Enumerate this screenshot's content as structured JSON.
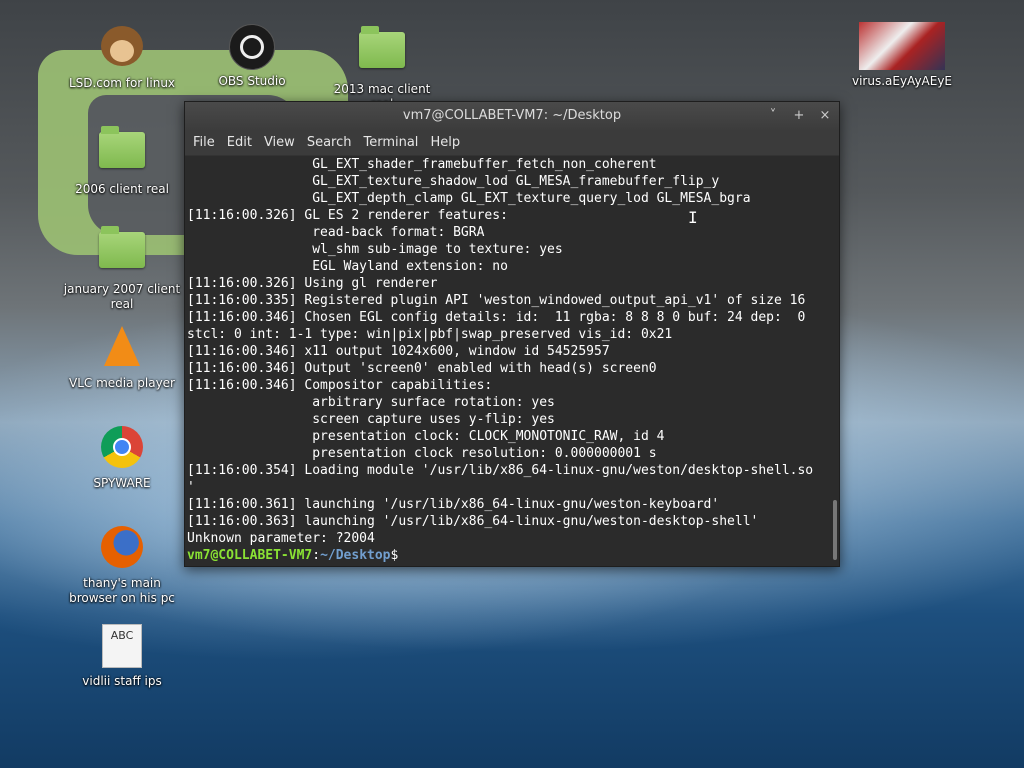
{
  "desktop": {
    "icons": [
      {
        "label": "LSD.com for linux",
        "icon": "monkey-icon"
      },
      {
        "label": "OBS Studio",
        "icon": "obs-icon"
      },
      {
        "label": "2013 mac client real",
        "icon": "folder-icon"
      },
      {
        "label": "virus.aEyAyAEyE",
        "icon": "image-thumbnail-icon"
      },
      {
        "label": "2006 client real",
        "icon": "folder-icon"
      },
      {
        "label": "january 2007 client real",
        "icon": "folder-icon"
      },
      {
        "label": "VLC media player",
        "icon": "vlc-icon"
      },
      {
        "label": "SPYWARE",
        "icon": "chrome-icon"
      },
      {
        "label": "thany's main browser on his pc",
        "icon": "firefox-icon"
      },
      {
        "label": "vidlii staff ips",
        "icon": "text-file-icon"
      }
    ]
  },
  "terminal": {
    "title": "vm7@COLLABET-VM7: ~/Desktop",
    "controls": {
      "minimize": "˅",
      "maximize": "+",
      "close": "×"
    },
    "menu": [
      "File",
      "Edit",
      "View",
      "Search",
      "Terminal",
      "Help"
    ],
    "lines": [
      "                GL_EXT_shader_framebuffer_fetch_non_coherent",
      "                GL_EXT_texture_shadow_lod GL_MESA_framebuffer_flip_y",
      "                GL_EXT_depth_clamp GL_EXT_texture_query_lod GL_MESA_bgra",
      "[11:16:00.326] GL ES 2 renderer features:",
      "                read-back format: BGRA",
      "                wl_shm sub-image to texture: yes",
      "                EGL Wayland extension: no",
      "[11:16:00.326] Using gl renderer",
      "[11:16:00.335] Registered plugin API 'weston_windowed_output_api_v1' of size 16",
      "[11:16:00.346] Chosen EGL config details: id:  11 rgba: 8 8 8 0 buf: 24 dep:  0",
      "stcl: 0 int: 1-1 type: win|pix|pbf|swap_preserved vis_id: 0x21",
      "[11:16:00.346] x11 output 1024x600, window id 54525957",
      "[11:16:00.346] Output 'screen0' enabled with head(s) screen0",
      "[11:16:00.346] Compositor capabilities:",
      "                arbitrary surface rotation: yes",
      "                screen capture uses y-flip: yes",
      "                presentation clock: CLOCK_MONOTONIC_RAW, id 4",
      "                presentation clock resolution: 0.000000001 s",
      "[11:16:00.354] Loading module '/usr/lib/x86_64-linux-gnu/weston/desktop-shell.so",
      "'",
      "[11:16:00.361] launching '/usr/lib/x86_64-linux-gnu/weston-keyboard'",
      "[11:16:00.363] launching '/usr/lib/x86_64-linux-gnu/weston-desktop-shell'",
      "Unknown parameter: ?2004"
    ],
    "prompt": {
      "user": "vm7@COLLABET-VM7",
      "sep": ":",
      "path": "~/Desktop",
      "symbol": "$"
    }
  }
}
